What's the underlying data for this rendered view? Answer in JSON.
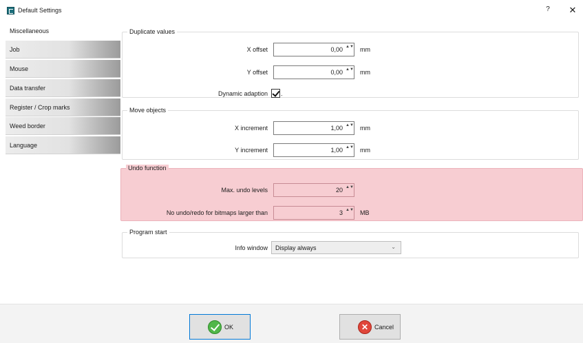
{
  "window": {
    "title": "Default Settings",
    "help_label": "?",
    "close_label": "✕"
  },
  "sidebar": {
    "items": [
      {
        "label": "Miscellaneous",
        "active": true
      },
      {
        "label": "Job"
      },
      {
        "label": "Mouse"
      },
      {
        "label": "Data transfer"
      },
      {
        "label": "Register / Crop marks"
      },
      {
        "label": "Weed border"
      },
      {
        "label": "Language"
      }
    ]
  },
  "duplicate": {
    "title": "Duplicate values",
    "x_offset": {
      "label": "X offset",
      "value": "0,00",
      "unit": "mm"
    },
    "y_offset": {
      "label": "Y offset",
      "value": "0,00",
      "unit": "mm"
    },
    "dynamic": {
      "label": "Dynamic adaption",
      "checked": true,
      "suffix": "."
    }
  },
  "move": {
    "title": "Move objects",
    "x_increment": {
      "label": "X increment",
      "value": "1,00",
      "unit": "mm"
    },
    "y_increment": {
      "label": "Y increment",
      "value": "1,00",
      "unit": "mm"
    }
  },
  "undo": {
    "title": "Undo function",
    "levels": {
      "label": "Max. undo levels",
      "value": "20"
    },
    "bitmaps": {
      "label": "No undo/redo for bitmaps larger than",
      "value": "3",
      "unit": "MB"
    },
    "highlight_color": "#f7cdd2"
  },
  "program_start": {
    "title": "Program start",
    "info_window": {
      "label": "Info window",
      "selected": "Display always"
    }
  },
  "footer": {
    "ok_label": "OK",
    "cancel_label": "Cancel"
  },
  "icons": {
    "spin": "▲▼",
    "chevron": "⌄",
    "cancel": "✕"
  }
}
